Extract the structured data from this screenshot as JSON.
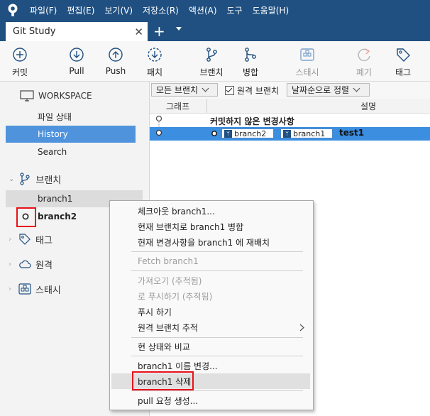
{
  "menubar": {
    "items": [
      "파일(F)",
      "편집(E)",
      "보기(V)",
      "저장소(R)",
      "액션(A)",
      "도구",
      "도움말(H)"
    ]
  },
  "tabs": {
    "active": "Git Study"
  },
  "toolbar": {
    "commit": "커밋",
    "pull": "Pull",
    "push": "Push",
    "fetch": "패치",
    "branch": "브랜치",
    "merge": "병합",
    "stash": "스태시",
    "discard": "폐기",
    "tag": "태그"
  },
  "sidebar": {
    "workspace": "WORKSPACE",
    "file_status": "파일 상태",
    "history": "History",
    "search": "Search",
    "branches": "브랜치",
    "branch_items": [
      "branch1",
      "branch2"
    ],
    "tags": "태그",
    "remotes": "원격",
    "stashes": "스태시"
  },
  "filter": {
    "branch_filter": "모든 브랜치",
    "remote_branch_label": "원격 브랜치",
    "remote_branch_checked": true,
    "sort": "날짜순으로 정렬"
  },
  "columns": {
    "graph": "그래프",
    "description": "설명"
  },
  "commits": {
    "uncommitted": "커밋하지 않은 변경사항",
    "row1_tags": [
      "branch2",
      "branch1"
    ],
    "row1_message": "test1"
  },
  "context_menu": {
    "items": [
      "체크아웃 branch1...",
      "현재 브랜치로 branch1 병합",
      "현재 변경사항을 branch1 에 재배치",
      "Fetch branch1",
      "가져오기 (추적됨)",
      "로 푸시하기 (추적됨)",
      "푸시 하기",
      "원격 브랜치 추적",
      "현 상태와 비교",
      "branch1 이름 변경...",
      "branch1 삭제",
      "pull 요청 생성..."
    ]
  },
  "colors": {
    "title_bar": "#205081",
    "selection": "#4f93dc",
    "commit_row": "#3b8ee0",
    "highlight_box": "#e8111a"
  }
}
